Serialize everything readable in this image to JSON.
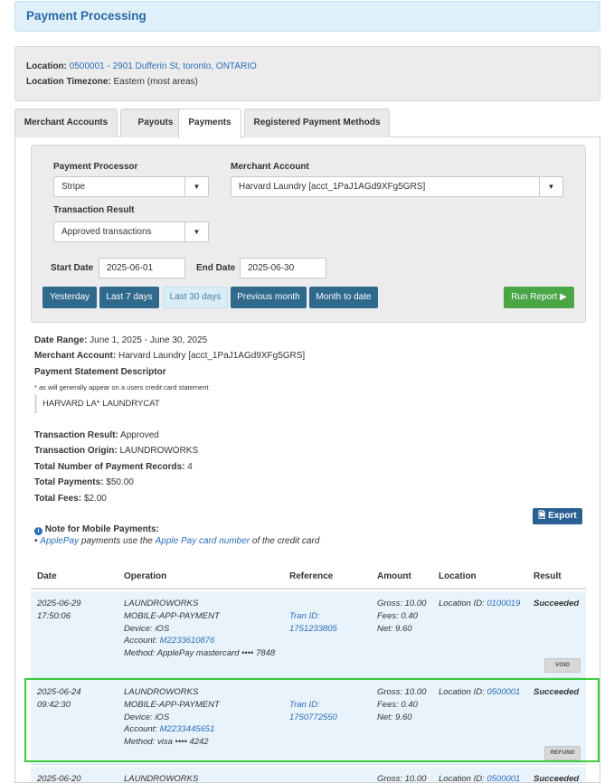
{
  "header": {
    "title": "Payment Processing"
  },
  "location": {
    "label": "Location:",
    "value": "0500001 - 2901 Dufferin St, toronto, ONTARIO",
    "tz_label": "Location Timezone:",
    "tz_value": "Eastern (most areas)"
  },
  "tabs": [
    {
      "label": "Merchant Accounts"
    },
    {
      "label": "Payouts"
    },
    {
      "label": "Payments"
    },
    {
      "label": "Registered Payment Methods"
    }
  ],
  "form": {
    "processor_label": "Payment Processor",
    "processor_value": "Stripe",
    "merchant_label": "Merchant Account",
    "merchant_value": "Harvard Laundry [acct_1PaJ1AGd9XFg5GRS]",
    "result_label": "Transaction Result",
    "result_value": "Approved transactions",
    "start_label": "Start Date",
    "start_value": "2025-06-01",
    "end_label": "End Date",
    "end_value": "2025-06-30",
    "quick": [
      "Yesterday",
      "Last 7 days",
      "Last 30 days",
      "Previous month",
      "Month to date"
    ],
    "run_label": "Run Report"
  },
  "summary": {
    "date_range_label": "Date Range:",
    "date_range": "June 1, 2025 - June 30, 2025",
    "merchant_label": "Merchant Account:",
    "merchant": "Harvard Laundry [acct_1PaJ1AGd9XFg5GRS]",
    "descriptor_heading": "Payment Statement Descriptor",
    "descriptor_note": "* as will generally appear on a users credit card statement",
    "descriptor": "HARVARD LA* LAUNDRYCAT",
    "result_label": "Transaction Result:",
    "result": "Approved",
    "origin_label": "Transaction Origin:",
    "origin": "LAUNDROWORKS",
    "count_label": "Total Number of Payment Records:",
    "count": "4",
    "payments_label": "Total Payments:",
    "payments": "$50.00",
    "fees_label": "Total Fees:",
    "fees": "$2.00"
  },
  "export_label": "Export",
  "mobile_note": {
    "heading": "Note for Mobile Payments:",
    "bullet": "•",
    "applepay": "ApplePay",
    "mid": "payments use the",
    "card_link": "Apple Pay card number",
    "tail": "of the credit card"
  },
  "table": {
    "headers": [
      "Date",
      "Operation",
      "Reference",
      "Amount",
      "Location",
      "Result"
    ],
    "rows": [
      {
        "date": "2025-06-29",
        "time": "17:50:06",
        "op1": "LAUNDROWORKS",
        "op2": "MOBILE-APP-PAYMENT",
        "device": "Device: iOS",
        "account_label": "Account:",
        "account": "M2233610876",
        "method": "Method: ApplePay mastercard •••• 7848",
        "ref_label": "Tran ID:",
        "ref": "1751233805",
        "gross": "Gross: 10.00",
        "fees": "Fees: 0.40",
        "net": "Net: 9.60",
        "loc_label": "Location ID:",
        "loc": "0100019",
        "result": "Succeeded",
        "action": "VOID"
      },
      {
        "date": "2025-06-24",
        "time": "09:42:30",
        "op1": "LAUNDROWORKS",
        "op2": "MOBILE-APP-PAYMENT",
        "device": "Device: iOS",
        "account_label": "Account:",
        "account": "M2233445651",
        "method": "Method: visa •••• 4242",
        "ref_label": "Tran ID:",
        "ref": "1750772550",
        "gross": "Gross: 10.00",
        "fees": "Fees: 0.40",
        "net": "Net: 9.60",
        "loc_label": "Location ID:",
        "loc": "0500001",
        "result": "Succeeded",
        "action": "REFUND"
      },
      {
        "date": "2025-06-20",
        "op1": "LAUNDROWORKS",
        "gross": "Gross: 10.00",
        "loc_label": "Location ID:",
        "loc": "0500001",
        "result": "Succeeded"
      }
    ]
  }
}
